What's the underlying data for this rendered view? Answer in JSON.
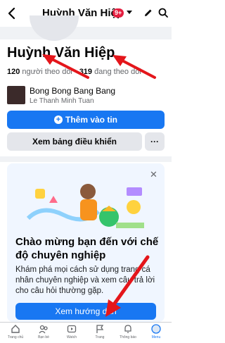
{
  "header": {
    "title": "Huỳnh Văn Hiệp",
    "badge": "9+"
  },
  "profile": {
    "name": "Huỳnh Văn Hiệp",
    "followers_count": "120",
    "followers_label": "người theo dõi",
    "separator": "·",
    "following_count": "319",
    "following_label": "đang theo dõi"
  },
  "song": {
    "title": "Bong Bong Bang Bang",
    "artist": "Le Thanh Minh Tuan"
  },
  "actions": {
    "add_story": "Thêm vào tin",
    "dashboard": "Xem bảng điều khiển",
    "more": "···"
  },
  "pro_card": {
    "title": "Chào mừng bạn đến với chế độ chuyên nghiệp",
    "description": "Khám phá mọi cách sử dụng trang cá nhân chuyên nghiệp và xem câu trả lời cho câu hỏi thường gặp.",
    "cta": "Xem hướng dẫn",
    "close": "✕"
  },
  "nav": [
    {
      "label": "Trang chủ",
      "icon": "home-icon"
    },
    {
      "label": "Bạn bè",
      "icon": "friends-icon"
    },
    {
      "label": "Watch",
      "icon": "video-icon"
    },
    {
      "label": "Trang",
      "icon": "flag-icon"
    },
    {
      "label": "Thông báo",
      "icon": "bell-icon"
    },
    {
      "label": "Menu",
      "icon": "menu-avatar-icon"
    }
  ],
  "colors": {
    "accent": "#1877f2",
    "annotation_arrow": "#e4161b"
  }
}
